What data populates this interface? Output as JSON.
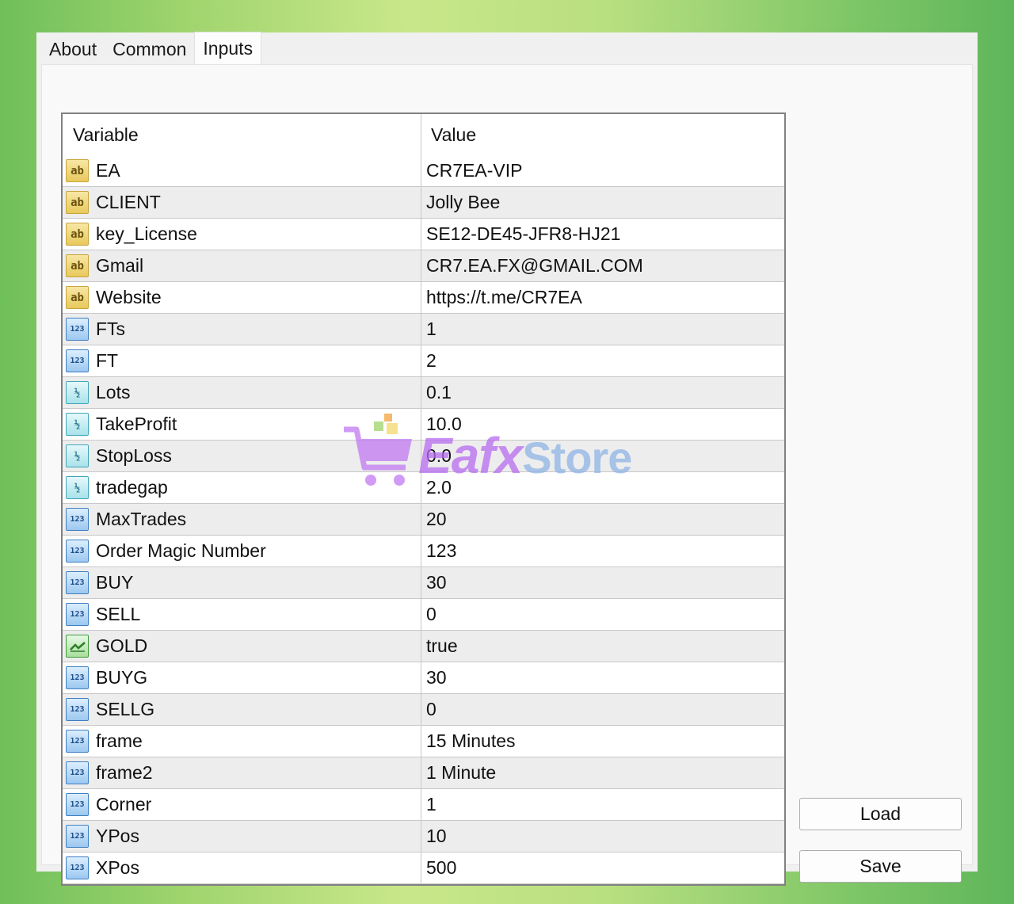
{
  "tabs": [
    {
      "label": "About"
    },
    {
      "label": "Common"
    },
    {
      "label": "Inputs"
    }
  ],
  "grid": {
    "headers": {
      "variable": "Variable",
      "value": "Value"
    },
    "rows": [
      {
        "type": "string",
        "icon": "string-type-icon",
        "icon_text": "ab",
        "variable": "EA",
        "value": "CR7EA-VIP"
      },
      {
        "type": "string",
        "icon": "string-type-icon",
        "icon_text": "ab",
        "variable": "CLIENT",
        "value": "Jolly Bee"
      },
      {
        "type": "string",
        "icon": "string-type-icon",
        "icon_text": "ab",
        "variable": "key_License",
        "value": "SE12-DE45-JFR8-HJ21"
      },
      {
        "type": "string",
        "icon": "string-type-icon",
        "icon_text": "ab",
        "variable": "Gmail",
        "value": "CR7.EA.FX@GMAIL.COM"
      },
      {
        "type": "string",
        "icon": "string-type-icon",
        "icon_text": "ab",
        "variable": "Website",
        "value": "https://t.me/CR7EA"
      },
      {
        "type": "int",
        "icon": "integer-type-icon",
        "icon_text": "123",
        "variable": "FTs",
        "value": "1"
      },
      {
        "type": "int",
        "icon": "integer-type-icon",
        "icon_text": "123",
        "variable": "FT",
        "value": "2"
      },
      {
        "type": "double",
        "icon": "double-type-icon",
        "icon_text": "½",
        "variable": "Lots",
        "value": "0.1"
      },
      {
        "type": "double",
        "icon": "double-type-icon",
        "icon_text": "½",
        "variable": "TakeProfit",
        "value": "10.0"
      },
      {
        "type": "double",
        "icon": "double-type-icon",
        "icon_text": "½",
        "variable": "StopLoss",
        "value": "0.0"
      },
      {
        "type": "double",
        "icon": "double-type-icon",
        "icon_text": "½",
        "variable": "tradegap",
        "value": "2.0"
      },
      {
        "type": "int",
        "icon": "integer-type-icon",
        "icon_text": "123",
        "variable": "MaxTrades",
        "value": "20"
      },
      {
        "type": "int",
        "icon": "integer-type-icon",
        "icon_text": "123",
        "variable": "Order Magic Number",
        "value": "123"
      },
      {
        "type": "int",
        "icon": "integer-type-icon",
        "icon_text": "123",
        "variable": "BUY",
        "value": "30"
      },
      {
        "type": "int",
        "icon": "integer-type-icon",
        "icon_text": "123",
        "variable": "SELL",
        "value": "0"
      },
      {
        "type": "bool",
        "icon": "boolean-type-icon",
        "icon_text": "",
        "variable": "GOLD",
        "value": "true"
      },
      {
        "type": "int",
        "icon": "integer-type-icon",
        "icon_text": "123",
        "variable": "BUYG",
        "value": "30"
      },
      {
        "type": "int",
        "icon": "integer-type-icon",
        "icon_text": "123",
        "variable": "SELLG",
        "value": "0"
      },
      {
        "type": "int",
        "icon": "integer-type-icon",
        "icon_text": "123",
        "variable": "frame",
        "value": "15 Minutes"
      },
      {
        "type": "int",
        "icon": "integer-type-icon",
        "icon_text": "123",
        "variable": "frame2",
        "value": "1 Minute"
      },
      {
        "type": "int",
        "icon": "integer-type-icon",
        "icon_text": "123",
        "variable": "Corner",
        "value": "1"
      },
      {
        "type": "int",
        "icon": "integer-type-icon",
        "icon_text": "123",
        "variable": "YPos",
        "value": "10"
      },
      {
        "type": "int",
        "icon": "integer-type-icon",
        "icon_text": "123",
        "variable": "XPos",
        "value": "500"
      }
    ]
  },
  "buttons": {
    "load": "Load",
    "save": "Save"
  },
  "watermark": {
    "part1": "Eafx",
    "part2": "Store"
  },
  "colors": {
    "window_bg": "#f0f0f0",
    "alt_row": "#ededed",
    "grid_border": "#808080"
  }
}
